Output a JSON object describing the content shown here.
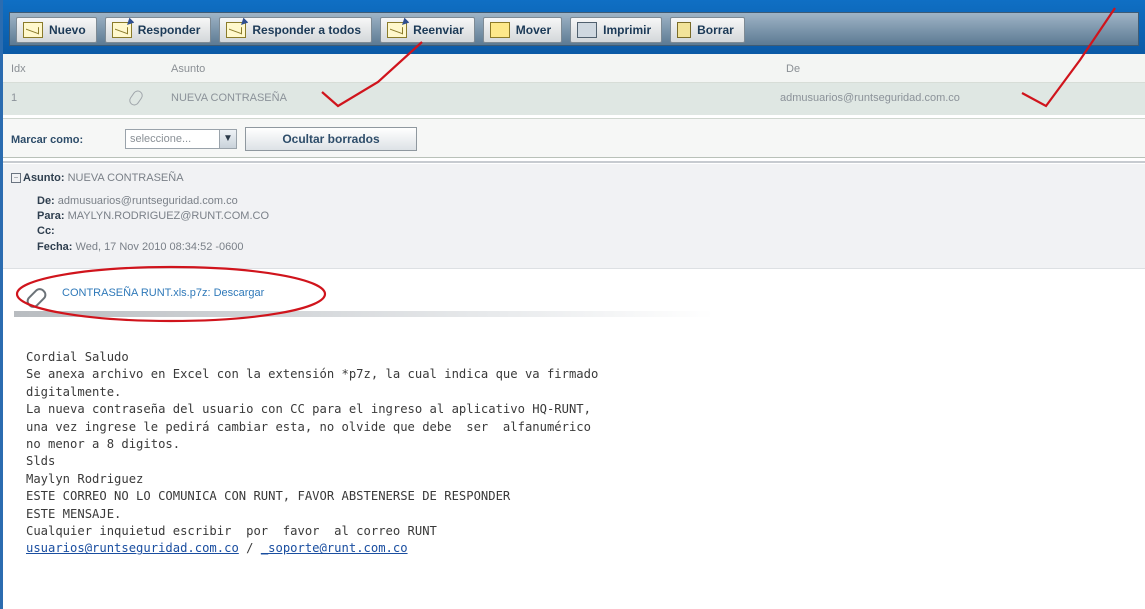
{
  "toolbar": {
    "buttons": [
      {
        "label": "Nuevo",
        "icon": "envelope-icon"
      },
      {
        "label": "Responder",
        "icon": "reply-icon"
      },
      {
        "label": "Responder a todos",
        "icon": "reply-all-icon"
      },
      {
        "label": "Reenviar",
        "icon": "forward-icon"
      },
      {
        "label": "Mover",
        "icon": "move-icon"
      },
      {
        "label": "Imprimir",
        "icon": "print-icon"
      },
      {
        "label": "Borrar",
        "icon": "trash-icon"
      }
    ]
  },
  "list": {
    "headers": {
      "idx": "Idx",
      "asunto": "Asunto",
      "de": "De"
    },
    "rows": [
      {
        "idx": "1",
        "asunto": "NUEVA CONTRASEÑA",
        "de": "admusuarios@runtseguridad.com.co"
      }
    ]
  },
  "markbar": {
    "label": "Marcar como:",
    "select_value": "seleccione...",
    "hide_deleted": "Ocultar borrados"
  },
  "message": {
    "subject_label": "Asunto:",
    "subject": "NUEVA CONTRASEÑA",
    "from_label": "De:",
    "from": "admusuarios@runtseguridad.com.co",
    "to_label": "Para:",
    "to": "MAYLYN.RODRIGUEZ@RUNT.COM.CO",
    "cc_label": "Cc:",
    "cc": "",
    "date_label": "Fecha:",
    "date": "Wed, 17 Nov 2010 08:34:52 -0600",
    "attachment": {
      "name": "CONTRASEÑA RUNT.xls.p7z:",
      "download": "Descargar"
    },
    "body_lines": [
      "Cordial Saludo",
      "Se anexa archivo en Excel con la extensión *p7z, la cual indica que va firmado",
      "digitalmente.",
      "La nueva contraseña del usuario con CC para el ingreso al aplicativo HQ-RUNT,",
      "una vez ingrese le pedirá cambiar esta, no olvide que debe  ser  alfanumérico",
      "no menor a 8 digitos.",
      "Slds",
      "Maylyn Rodriguez",
      "ESTE CORREO NO LO COMUNICA CON RUNT, FAVOR ABSTENERSE DE RESPONDER",
      "ESTE MENSAJE.",
      "Cualquier inquietud escribir  por  favor  al correo RUNT"
    ],
    "link1": "usuarios@runtseguridad.com.co",
    "link_sep": " / ",
    "link2": "_soporte@runt.com.co"
  }
}
